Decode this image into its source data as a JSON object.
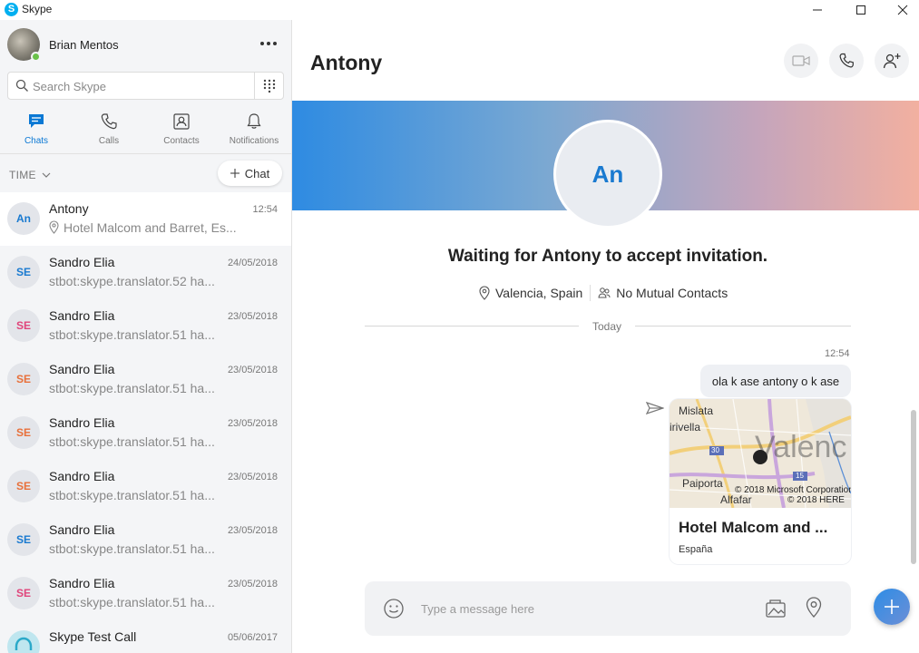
{
  "window": {
    "title": "Skype",
    "icon": "skype-logo-icon"
  },
  "sidebar": {
    "profile_name": "Brian Mentos",
    "status_color": "#6ac24a",
    "search_placeholder": "Search Skype",
    "nav": [
      {
        "label": "Chats",
        "icon": "chat-icon",
        "active": true
      },
      {
        "label": "Calls",
        "icon": "phone-icon",
        "active": false
      },
      {
        "label": "Contacts",
        "icon": "contacts-icon",
        "active": false
      },
      {
        "label": "Notifications",
        "icon": "bell-icon",
        "active": false
      }
    ],
    "sort_label": "TIME",
    "new_chat_label": "Chat",
    "conversations": [
      {
        "initials": "An",
        "name": "Antony",
        "time": "12:54",
        "preview": "Hotel Malcom and Barret, Es...",
        "has_location": true,
        "selected": true,
        "avatar_color": "#1a7ad0"
      },
      {
        "initials": "SE",
        "name": "Sandro Elia",
        "time": "24/05/2018",
        "preview": "stbot:skype.translator.52 ha...",
        "avatar_color": "#1a7ad0"
      },
      {
        "initials": "SE",
        "name": "Sandro Elia",
        "time": "23/05/2018",
        "preview": "stbot:skype.translator.51 ha...",
        "avatar_color": "#e0457b"
      },
      {
        "initials": "SE",
        "name": "Sandro Elia",
        "time": "23/05/2018",
        "preview": "stbot:skype.translator.51 ha...",
        "avatar_color": "#e8703a"
      },
      {
        "initials": "SE",
        "name": "Sandro Elia",
        "time": "23/05/2018",
        "preview": "stbot:skype.translator.51 ha...",
        "avatar_color": "#e8703a"
      },
      {
        "initials": "SE",
        "name": "Sandro Elia",
        "time": "23/05/2018",
        "preview": "stbot:skype.translator.51 ha...",
        "avatar_color": "#e8703a"
      },
      {
        "initials": "SE",
        "name": "Sandro Elia",
        "time": "23/05/2018",
        "preview": "stbot:skype.translator.51 ha...",
        "avatar_color": "#1a7ad0"
      },
      {
        "initials": "SE",
        "name": "Sandro Elia",
        "time": "23/05/2018",
        "preview": "stbot:skype.translator.51 ha...",
        "avatar_color": "#e0457b"
      },
      {
        "initials": "",
        "name": "Skype Test Call",
        "time": "05/06/2017",
        "preview": "",
        "avatar_color": "#2aa9c9"
      }
    ]
  },
  "chat": {
    "title": "Antony",
    "avatar_initials": "An",
    "invite_text": "Waiting for Antony to accept invitation.",
    "location": "Valencia, Spain",
    "mutual": "No Mutual Contacts",
    "day_label": "Today",
    "message_time": "12:54",
    "message_text": "ola k ase antony o k ase",
    "map": {
      "labels": {
        "mislata": "Mislata",
        "irivella": "irivella",
        "paiporta": "Paiporta",
        "alfafar": "Alfafar",
        "city": "Valenc",
        "road30": "30",
        "road15": "15"
      },
      "copyright1": "© 2018 Microsoft Corporation",
      "copyright2": "© 2018 HERE",
      "title": "Hotel Malcom and ...",
      "subtitle": "España"
    },
    "composer_placeholder": "Type a message here"
  },
  "colors": {
    "accent": "#0a78d4",
    "banner_start": "#2e8be2",
    "banner_end": "#f2b0a0"
  }
}
